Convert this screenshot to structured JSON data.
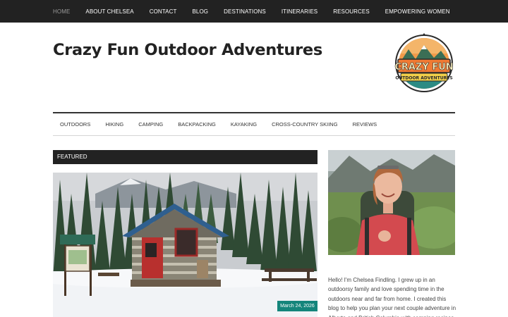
{
  "topnav": {
    "items": [
      {
        "label": "HOME",
        "active": true
      },
      {
        "label": "ABOUT CHELSEA"
      },
      {
        "label": "CONTACT"
      },
      {
        "label": "BLOG"
      },
      {
        "label": "DESTINATIONS"
      },
      {
        "label": "ITINERARIES"
      },
      {
        "label": "RESOURCES"
      },
      {
        "label": "EMPOWERING WOMEN"
      }
    ]
  },
  "header": {
    "title": "Crazy Fun Outdoor Adventures",
    "logo": {
      "line1": "CRAZY FUN",
      "line2": "OUTDOOR ADVENTURES"
    }
  },
  "subnav": {
    "items": [
      "OUTDOORS",
      "HIKING",
      "CAMPING",
      "BACKPACKING",
      "KAYAKING",
      "CROSS-COUNTRY SKIING",
      "REVIEWS"
    ]
  },
  "featured": {
    "heading": "FEATURED",
    "date": "March 24, 2026"
  },
  "sidebar": {
    "about_text": "Hello! I'm Chelsea Findling. I grew up in an outdoorsy family and love spending time in the outdoors near and far from home. I created this blog to help you plan your next couple adventure in Alberta and British Columbia with camping recipes"
  },
  "colors": {
    "topbar": "#222222",
    "accent": "#14857b",
    "title": "#222222"
  }
}
